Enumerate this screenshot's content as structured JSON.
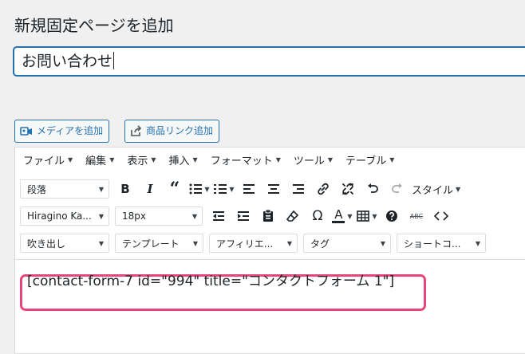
{
  "page": {
    "title": "新規固定ページを追加"
  },
  "post_title": {
    "value": "お問い合わせ"
  },
  "media_buttons": {
    "add_media": "メディアを追加",
    "product_link": "商品リンク追加"
  },
  "menubar": [
    "ファイル",
    "編集",
    "表示",
    "挿入",
    "フォーマット",
    "ツール",
    "テーブル"
  ],
  "toolbar1": {
    "format_select": "段落",
    "style_label": "スタイル"
  },
  "toolbar2": {
    "font_family": "Hiragino Ka...",
    "font_size": "18px",
    "omega": "Ω",
    "text_color_letter": "A",
    "strike_label": "ABC"
  },
  "toolbar3": {
    "speech_bubble": "吹き出し",
    "template": "テンプレート",
    "affiliate": "アフィリエ...",
    "tag": "タグ",
    "shortcode": "ショートコ..."
  },
  "content": {
    "shortcode": "[contact-form-7 id=\"994\" title=\"コンタクトフォーム 1\"]"
  },
  "colors": {
    "accent": "#2271b1",
    "highlight_border": "#e8467a",
    "background": "#f0f0f1"
  }
}
